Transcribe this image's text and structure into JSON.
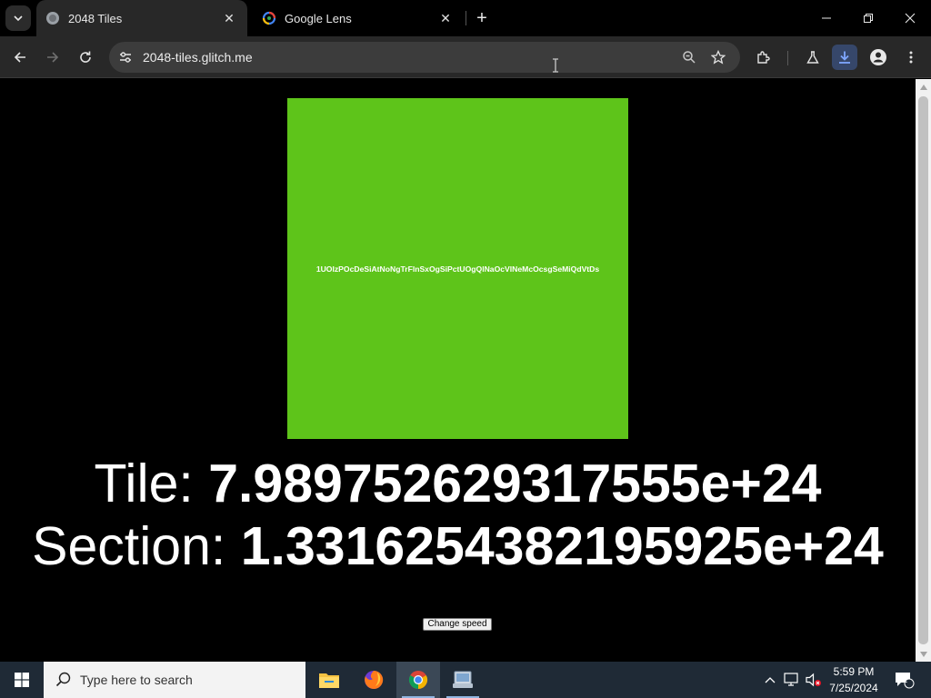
{
  "browser": {
    "tabs": [
      {
        "title": "2048 Tiles",
        "active": true
      },
      {
        "title": "Google Lens",
        "active": false
      }
    ],
    "new_tab_symbol": "+",
    "url": "2048-tiles.glitch.me",
    "window_controls": [
      "minimize-icon",
      "restore-icon",
      "close-icon"
    ]
  },
  "page": {
    "tile_code": "1UOIzPOcDeSiAtNoNgTrFlnSxOgSiPctUOgQlNaOcVlNeMcOcsgSeMiQdVtDs",
    "tile_color": "#5ec41a",
    "tile_label": "Tile:",
    "tile_value": "7.989752629317555e+24",
    "section_label": "Section:",
    "section_value": "1.331625438219592 5e+24",
    "change_speed_label": "Change speed"
  },
  "taskbar": {
    "search_placeholder": "Type here to search",
    "apps": [
      "file-explorer-icon",
      "firefox-icon",
      "chrome-icon",
      "app-icon"
    ],
    "clock_time": "5:59 PM",
    "clock_date": "7/25/2024",
    "notification_count": "1"
  }
}
